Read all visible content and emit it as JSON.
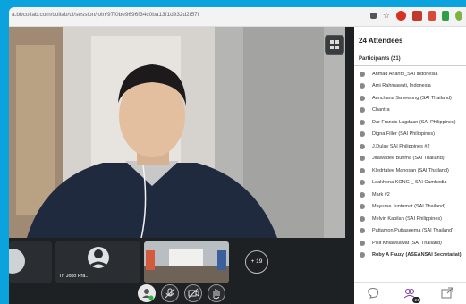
{
  "browser": {
    "url": "a.bbcollab.com/collab/ui/session/join/97f0be9696f34c0ba13f1d932d2f57f"
  },
  "panel": {
    "title": "24 Attendees",
    "participants_header": "Participants (21)",
    "participants": [
      "Ahmad Arianto_SAI Indonesia",
      "Arni Rahmawati, Indonesia",
      "Aunchana Sanewong (SAI Thailand)",
      "Chantra",
      "Dar Francis Lagdaan (SAI Philippines)",
      "Digna Filler (SAI Philippines)",
      "J.Dulay SAI Philippines #2",
      "Jirawadee Bunma (SAI Thailand)",
      "Kledrtatee Manosan (SAI Thailand)",
      "Leakhena KONG _ SAI Cambodia",
      "Mark #2",
      "Mayuree Juntamat (SAI Thailand)",
      "Melvin Kabilan (SAI Philippines)",
      "Pattamon Puttaseema (SAI Thailand)",
      "Pisit Khiawsawat (SAI Thailand)",
      "Roby A Fauzy (ASEANSAI Secretariat)"
    ],
    "footer_badge": "24"
  },
  "stage": {
    "thumb_name": "Tri Joko Pra...",
    "more_label": "+ 19"
  },
  "colors": {
    "frame": "#0aa3dd",
    "stage_bg": "#1e2124",
    "panel_bg": "#ffffff"
  },
  "icons": {
    "layout": "grid-layout-icon",
    "toolbar": [
      "avatar-status-icon",
      "microphone-off-icon",
      "camera-off-icon",
      "raise-hand-icon"
    ],
    "footer": [
      "chat-icon",
      "attendees-icon",
      "share-content-icon"
    ]
  }
}
